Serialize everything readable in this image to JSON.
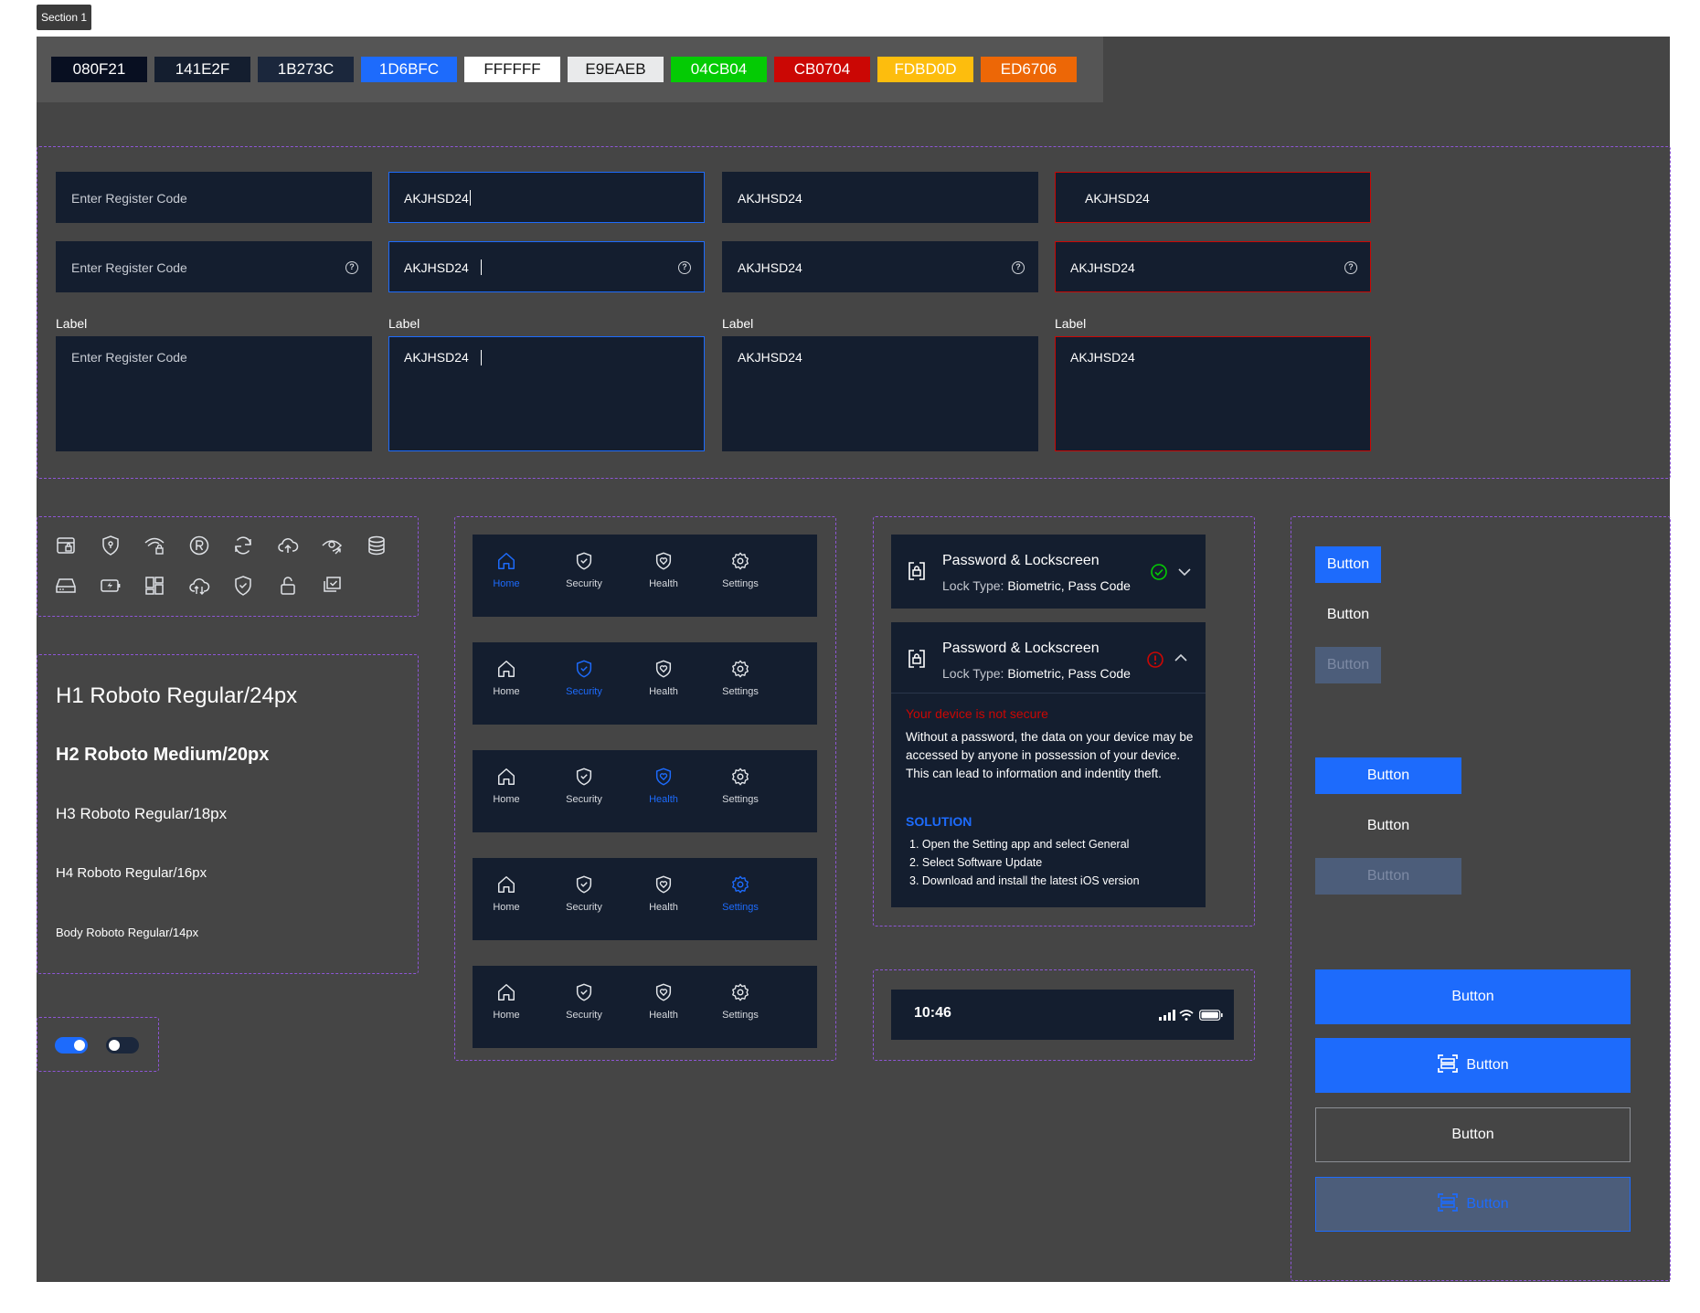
{
  "section_tag": "Section 1",
  "palette": [
    {
      "label": "080F21",
      "bg": "#080F21",
      "fg": "#FFFFFF"
    },
    {
      "label": "141E2F",
      "bg": "#141E2F",
      "fg": "#FFFFFF"
    },
    {
      "label": "1B273C",
      "bg": "#1B273C",
      "fg": "#FFFFFF"
    },
    {
      "label": "1D6BFC",
      "bg": "#1D6BFC",
      "fg": "#FFFFFF"
    },
    {
      "label": "FFFFFF",
      "bg": "#FFFFFF",
      "fg": "#111111"
    },
    {
      "label": "E9EAEB",
      "bg": "#E9EAEB",
      "fg": "#111111"
    },
    {
      "label": "04CB04",
      "bg": "#04CB04",
      "fg": "#FFFFFF"
    },
    {
      "label": "CB0704",
      "bg": "#CB0704",
      "fg": "#FFFFFF"
    },
    {
      "label": "FDBD0D",
      "bg": "#FDBD0D",
      "fg": "#FFFFFF"
    },
    {
      "label": "ED6706",
      "bg": "#ED6706",
      "fg": "#FFFFFF"
    }
  ],
  "inputs": {
    "placeholder": "Enter Register Code",
    "value": "AKJHSD24",
    "label": "Label",
    "help_glyph": "?"
  },
  "icons_grid": [
    "card-lock-icon",
    "shield-lock-icon",
    "wifi-lock-icon",
    "registered-icon",
    "sync-icon",
    "cloud-upload-icon",
    "eye-share-icon",
    "database-icon",
    "storage-drive-icon",
    "battery-charge-icon",
    "dashboard-grid-icon",
    "cloud-sync-icon",
    "shield-check-icon",
    "unlock-icon",
    "photos-check-icon"
  ],
  "nav": {
    "items": [
      "Home",
      "Security",
      "Health",
      "Settings"
    ]
  },
  "typography": {
    "h1": "H1 Roboto Regular/24px",
    "h2": "H2 Roboto Medium/20px",
    "h3": "H3 Roboto Regular/18px",
    "h4": "H4 Roboto Regular/16px",
    "body": "Body Roboto Regular/14px"
  },
  "cards": {
    "title": "Password & Lockscreen",
    "sub_prefix": "Lock Type: ",
    "sub_value": "Biometric, Pass Code",
    "warning_title": "Your device is not secure",
    "warning_body": "Without a password, the data on your device may be accessed by anyone in possession of your device. This can lead to information and indentity theft.",
    "solution_title": "SOLUTION",
    "solution_steps": [
      "1. Open the Setting app and select General",
      "2. Select Software Update",
      "3. Download and install the latest iOS version"
    ]
  },
  "statusbar": {
    "time": "10:46"
  },
  "buttons": {
    "label": "Button"
  },
  "colors": {
    "primary": "#1D6BFC",
    "surface": "#141E2F",
    "success": "#04CB04",
    "error": "#CB0704"
  }
}
